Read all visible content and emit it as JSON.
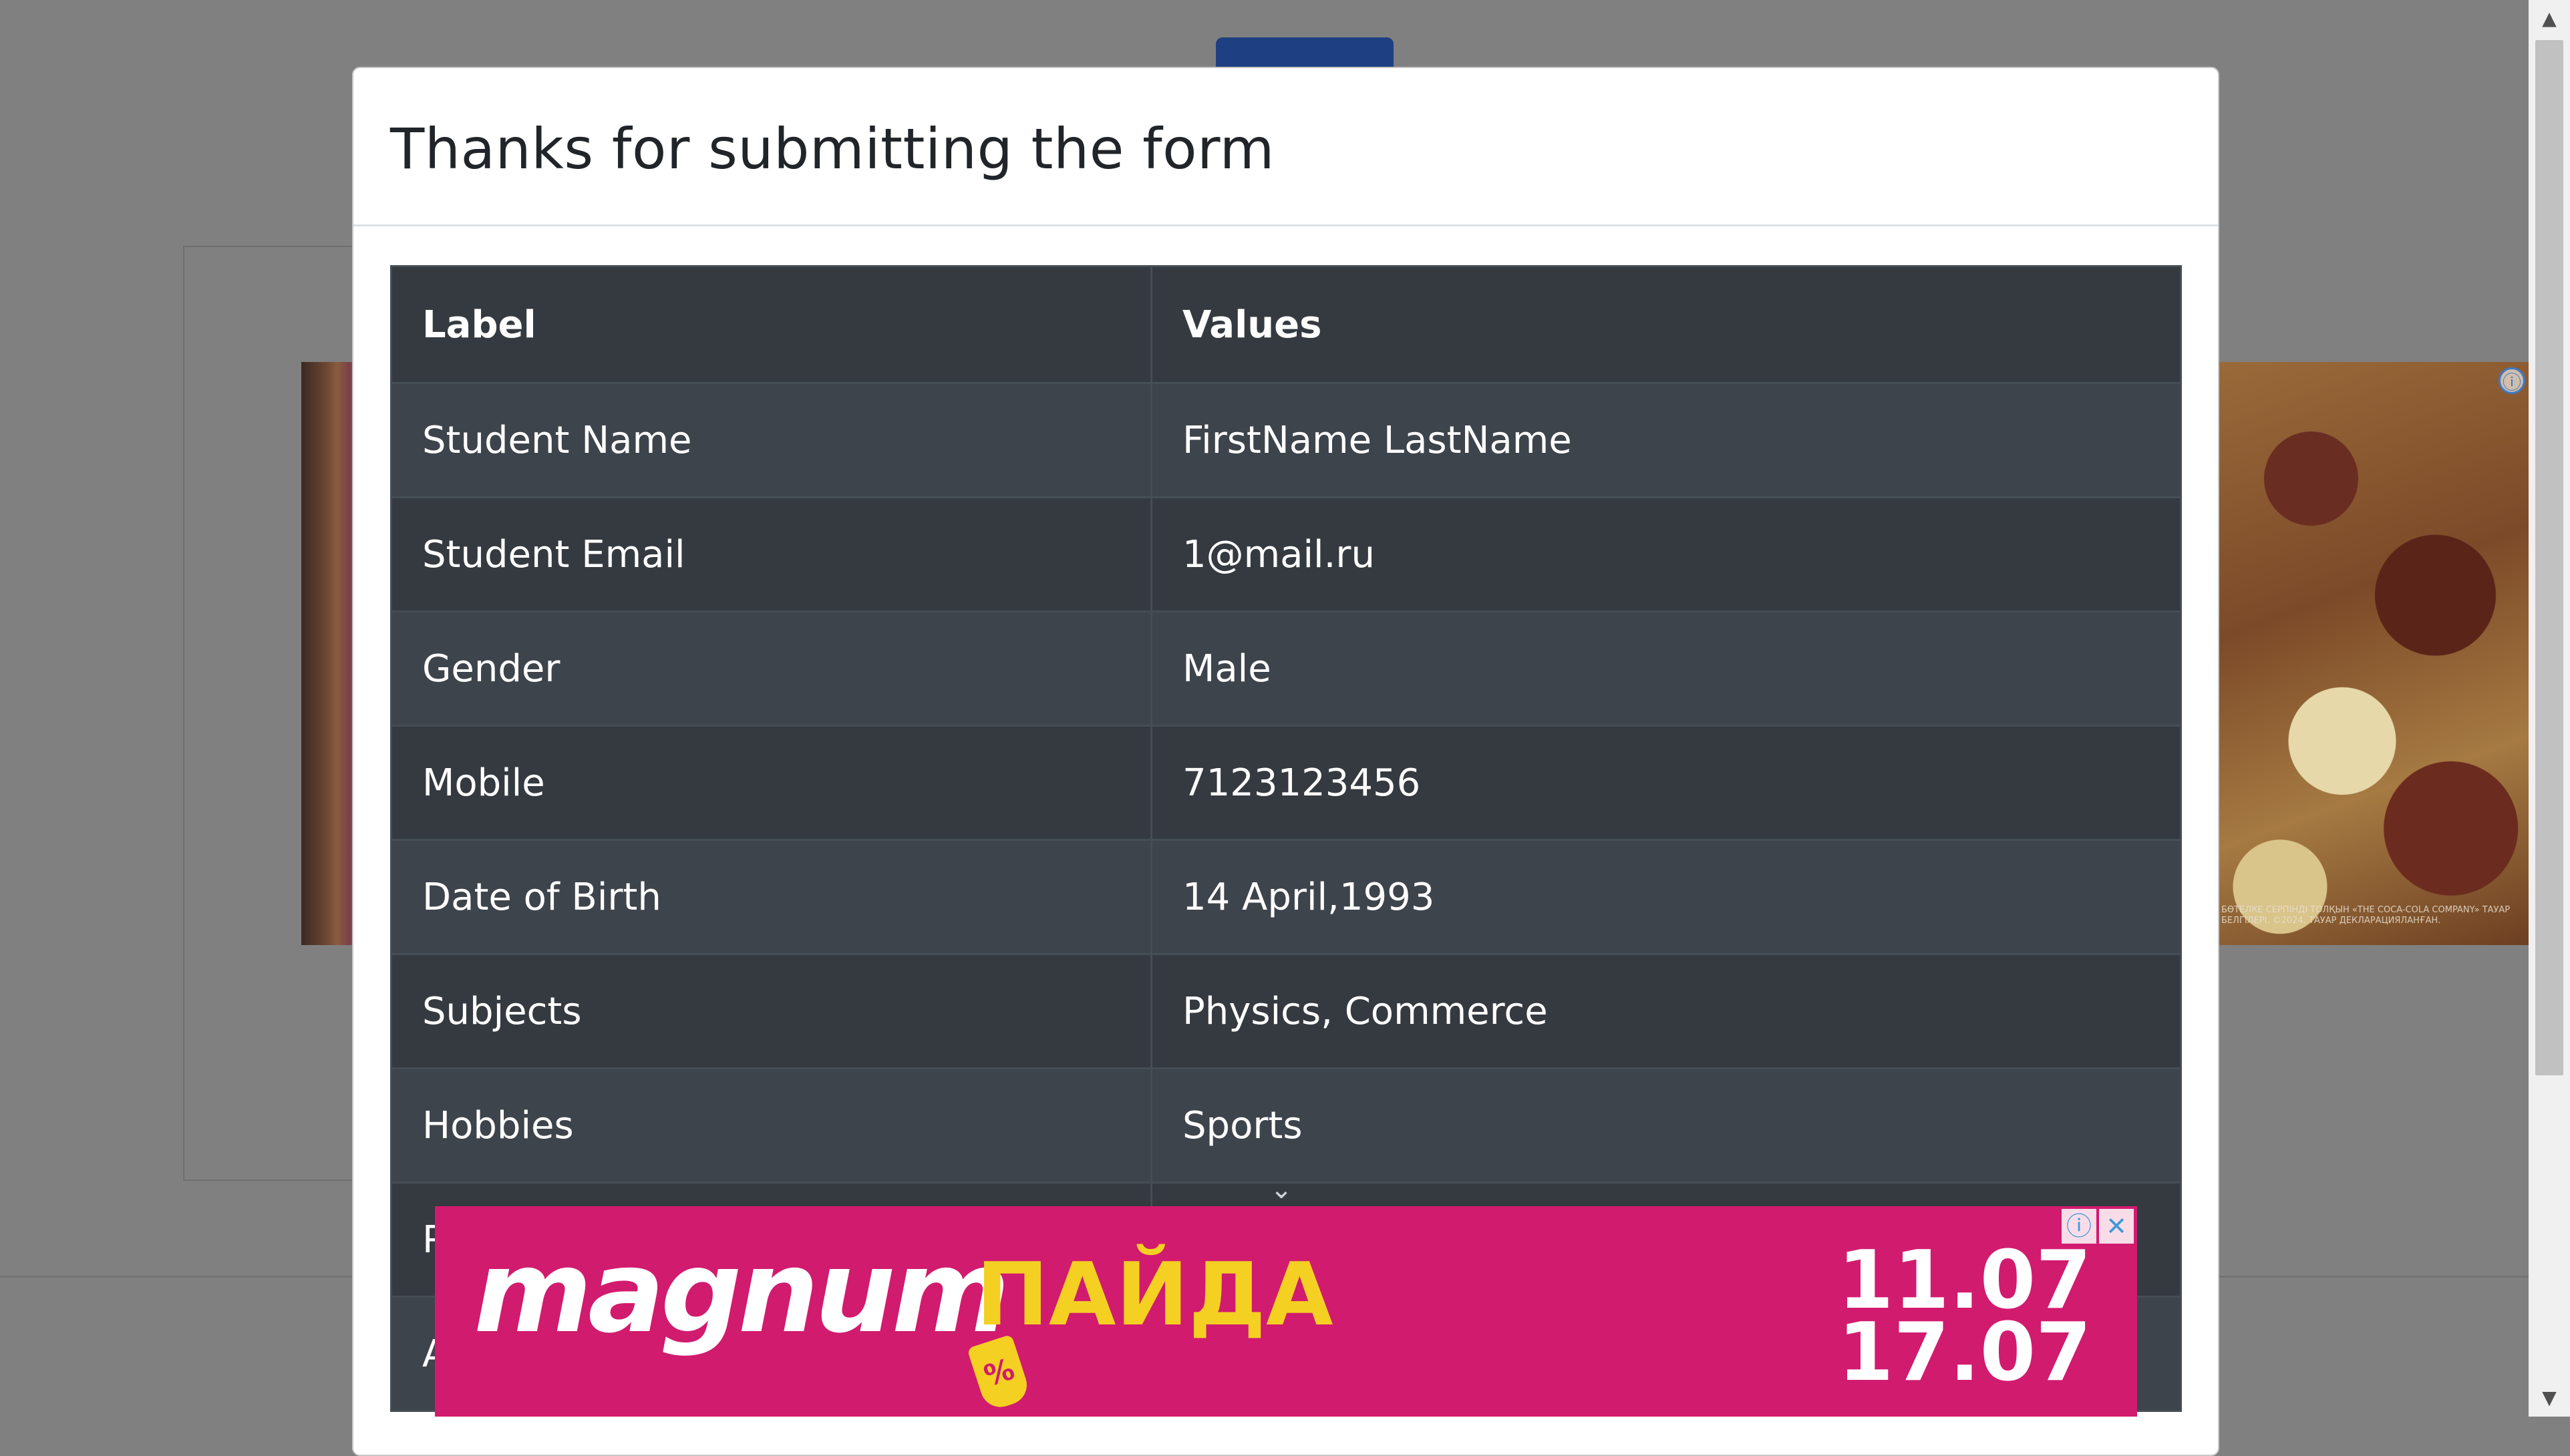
{
  "modal": {
    "title": "Thanks for submitting the form"
  },
  "table": {
    "headers": [
      "Label",
      "Values"
    ],
    "rows": [
      {
        "label": "Student Name",
        "value": "FirstName LastName"
      },
      {
        "label": "Student Email",
        "value": "1@mail.ru"
      },
      {
        "label": "Gender",
        "value": "Male"
      },
      {
        "label": "Mobile",
        "value": "7123123456"
      },
      {
        "label": "Date of Birth",
        "value": "14 April,1993"
      },
      {
        "label": "Subjects",
        "value": "Physics, Commerce"
      },
      {
        "label": "Hobbies",
        "value": "Sports"
      },
      {
        "label": "P",
        "value": ""
      },
      {
        "label": "A",
        "value": ""
      }
    ]
  },
  "ad_banner": {
    "brand": "magnum",
    "brand_suffix": "ПАЙДА",
    "tag_symbol": "%",
    "date_start": "11.07",
    "date_end": "17.07",
    "info_icon": "info-icon",
    "close_icon": "close-icon",
    "background_color": "#d11b6e",
    "accent_color": "#f4d023"
  },
  "side_ad": {
    "fineprint": "БӨТЕЛКЕ СЕРПІНДІ ТОЛҚЫН «THE COCA-COLA COMPANY» ТАУАР БЕЛГІЛЕРІ. ©2024. ТАУАР ДЕКЛАРАЦИЯЛАНҒАН."
  },
  "colors": {
    "table_dark": "#343a40",
    "table_alt": "#3e444b",
    "overlay": "#808080"
  }
}
